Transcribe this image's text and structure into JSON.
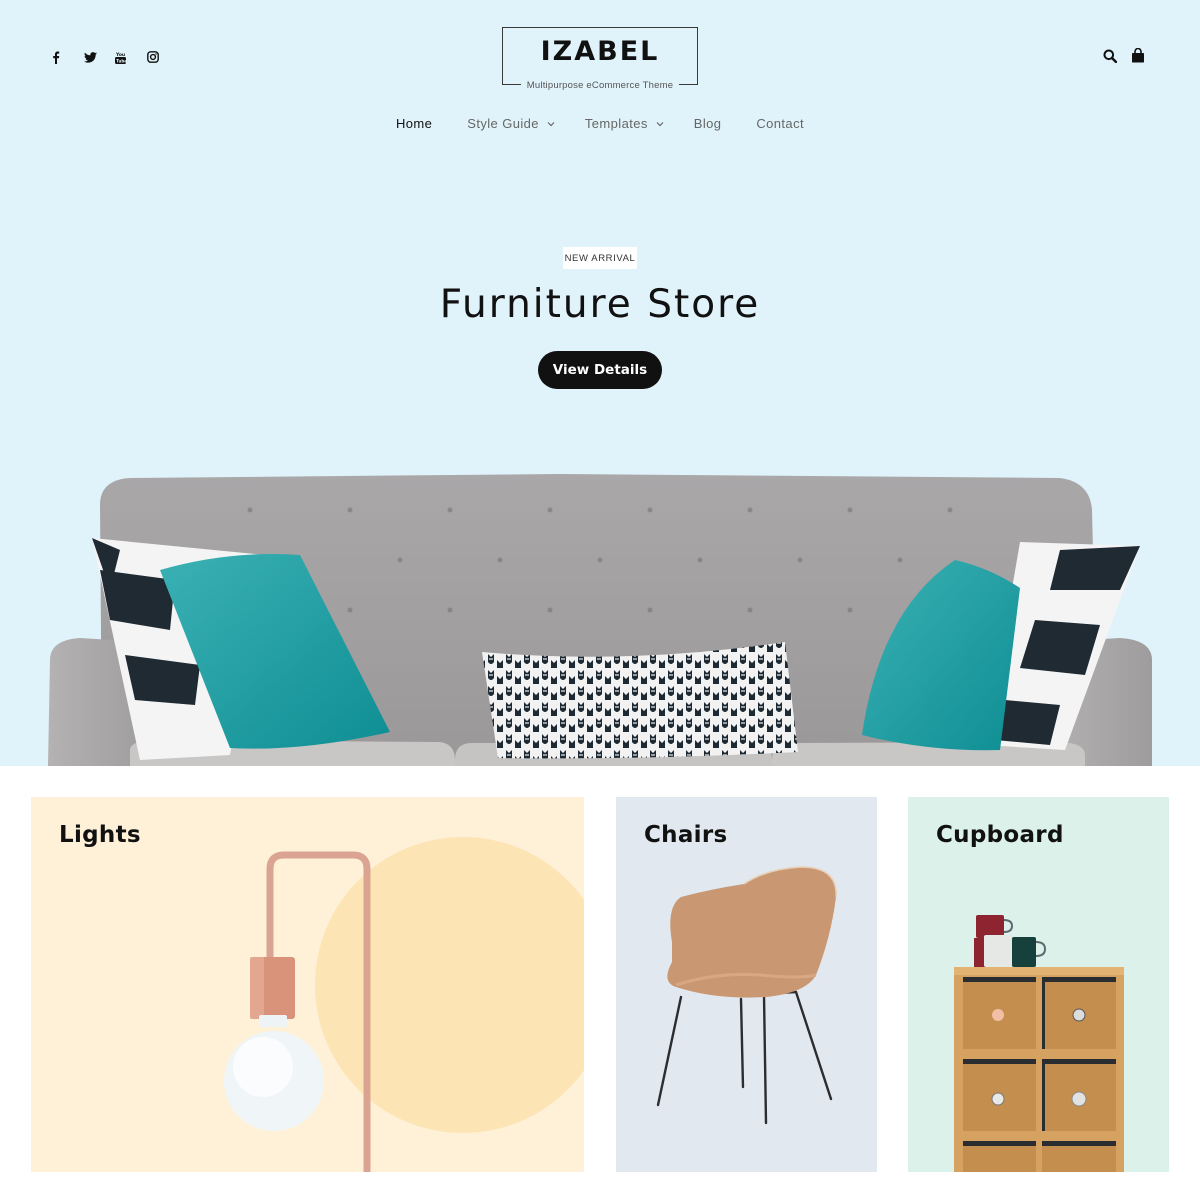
{
  "header": {
    "social_icons": [
      {
        "name": "facebook-icon",
        "label": "Facebook"
      },
      {
        "name": "twitter-icon",
        "label": "Twitter"
      },
      {
        "name": "youtube-icon",
        "label": "YouTube"
      },
      {
        "name": "instagram-icon",
        "label": "Instagram"
      }
    ],
    "logo": {
      "name": "IZABEL",
      "tagline": "Multipurpose eCommerce Theme"
    },
    "right_icons": [
      {
        "name": "search-icon",
        "label": "Search"
      },
      {
        "name": "shopping-bag-icon",
        "label": "Cart"
      }
    ]
  },
  "nav": {
    "items": [
      {
        "label": "Home",
        "active": true,
        "has_dropdown": false
      },
      {
        "label": "Style Guide",
        "active": false,
        "has_dropdown": true
      },
      {
        "label": "Templates",
        "active": false,
        "has_dropdown": true
      },
      {
        "label": "Blog",
        "active": false,
        "has_dropdown": false
      },
      {
        "label": "Contact",
        "active": false,
        "has_dropdown": false
      }
    ]
  },
  "hero": {
    "badge": "NEW ARRIVAL",
    "title": "Furniture Store",
    "cta_label": "View Details",
    "image_alt": "Grey tufted sofa with teal and patterned cushions"
  },
  "categories": [
    {
      "label": "Lights",
      "color": "#fef1d8",
      "image_alt": "Copper lamp with bulb"
    },
    {
      "label": "Chairs",
      "color": "#e1e8ef",
      "image_alt": "Tan shell armchair"
    },
    {
      "label": "Cupboard",
      "color": "#dcf1ea",
      "image_alt": "Wooden drawer cabinet with mugs"
    }
  ],
  "colors": {
    "hero_bg": "#e0f3fa",
    "cta_bg": "#111111",
    "text_primary": "#111111",
    "text_nav": "#666666"
  }
}
